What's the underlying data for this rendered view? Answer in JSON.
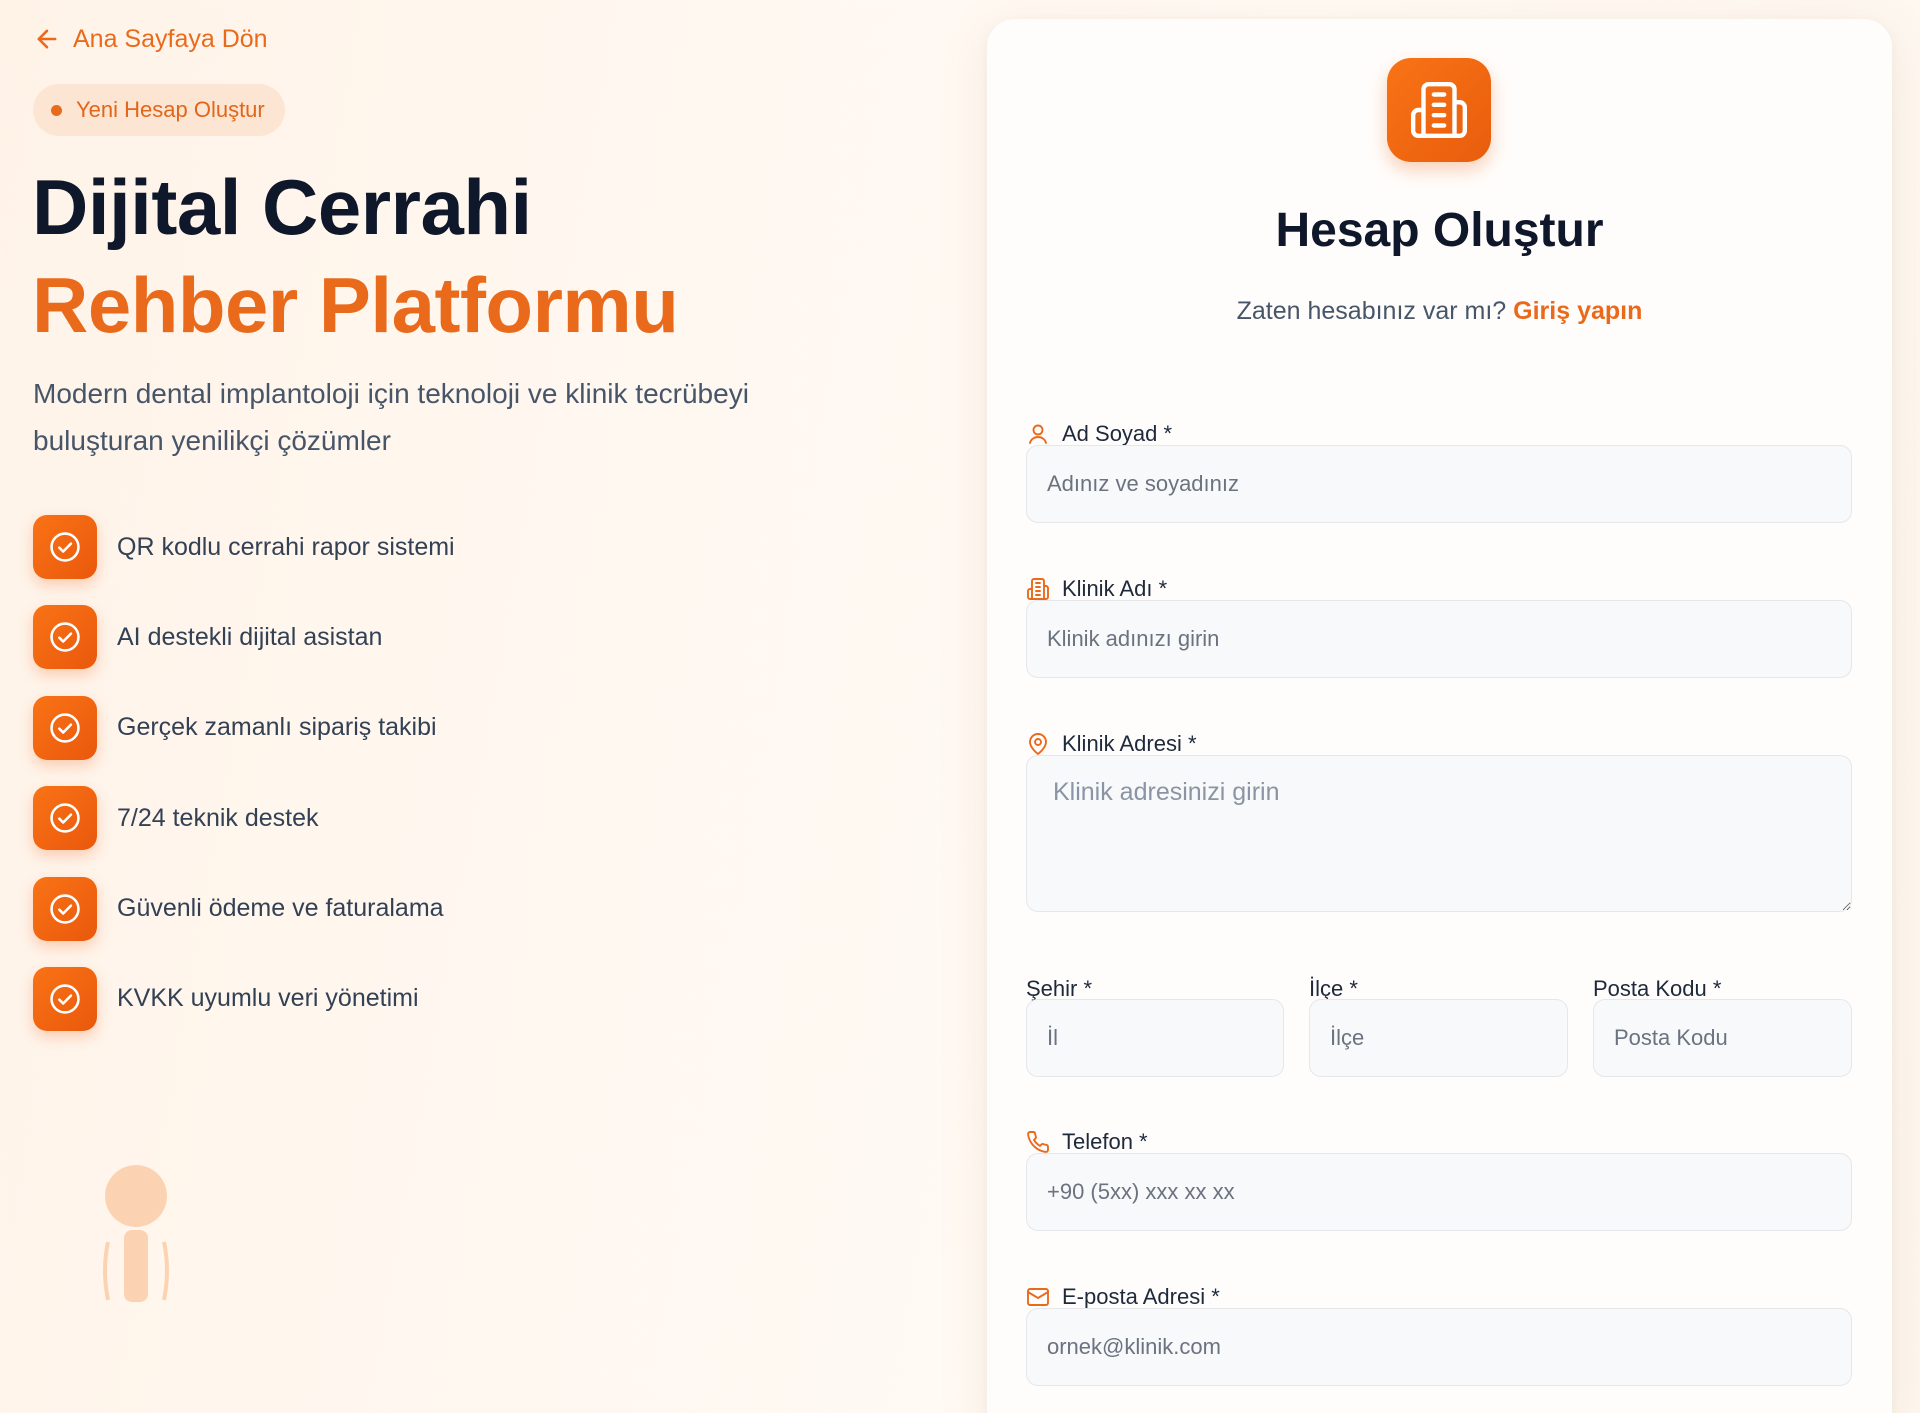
{
  "back_link": {
    "label": "Ana Sayfaya Dön"
  },
  "badge": {
    "label": "Yeni Hesap Oluştur"
  },
  "hero": {
    "title_line1": "Dijital Cerrahi",
    "title_line2": "Rehber Platformu",
    "description": "Modern dental implantoloji için teknoloji ve klinik tecrübeyi buluşturan yenilikçi çözümler"
  },
  "features": [
    "QR kodlu cerrahi rapor sistemi",
    "AI destekli dijital asistan",
    "Gerçek zamanlı sipariş takibi",
    "7/24 teknik destek",
    "Güvenli ödeme ve faturalama",
    "KVKK uyumlu veri yönetimi"
  ],
  "form": {
    "title": "Hesap Oluştur",
    "subtitle_prefix": "Zaten hesabınız var mı?",
    "login_link": "Giriş yapın",
    "fields": {
      "full_name": {
        "label": "Ad Soyad *",
        "placeholder": "Adınız ve soyadınız",
        "icon": "user-icon"
      },
      "clinic_name": {
        "label": "Klinik Adı *",
        "placeholder": "Klinik adınızı girin",
        "icon": "building-icon"
      },
      "clinic_address": {
        "label": "Klinik Adresi *",
        "placeholder": "Klinik adresinizi girin",
        "icon": "map-pin-icon"
      },
      "city": {
        "label": "Şehir *",
        "placeholder": "İl"
      },
      "district": {
        "label": "İlçe *",
        "placeholder": "İlçe"
      },
      "postal_code": {
        "label": "Posta Kodu *",
        "placeholder": "Posta Kodu"
      },
      "phone": {
        "label": "Telefon *",
        "placeholder": "+90 (5xx) xxx xx xx",
        "icon": "phone-icon"
      },
      "email": {
        "label": "E-posta Adresi *",
        "placeholder": "ornek@klinik.com",
        "icon": "mail-icon"
      }
    }
  },
  "colors": {
    "accent": "#ea6a1c",
    "heading": "#0f172a",
    "body_text": "#475569"
  }
}
